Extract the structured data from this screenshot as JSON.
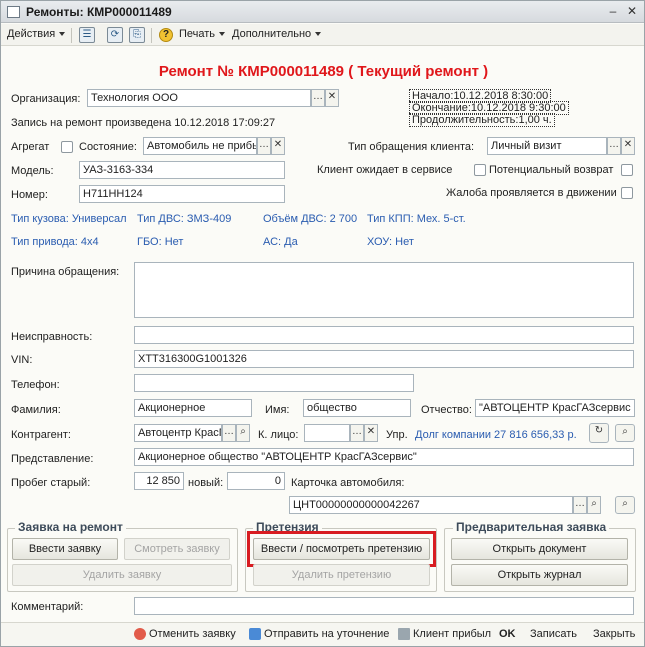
{
  "window": {
    "title": "Ремонты: КМР000011489"
  },
  "toolbar": {
    "actions": "Действия",
    "print": "Печать",
    "more": "Дополнительно"
  },
  "header": {
    "title": "Ремонт № КМР000011489 ( Текущий ремонт )"
  },
  "org": {
    "label": "Организация:",
    "value": "Технология ООО"
  },
  "timing": {
    "start": "Начало:10.12.2018 8:30:00",
    "end": "Окончание:10.12.2018 9:30:00",
    "duration": "Продолжительность:1,00 ч."
  },
  "record": "Запись на ремонт произведена 10.12.2018 17:09:27",
  "aggregate_label": "Агрегат",
  "state": {
    "label": "Состояние:",
    "value": "Автомобиль не прибь"
  },
  "client_type": {
    "label": "Тип обращения клиента:",
    "value": "Личный визит"
  },
  "model": {
    "label": "Модель:",
    "value": "УАЗ-3163-334"
  },
  "number": {
    "label": "Номер:",
    "value": "Н711НН124"
  },
  "client_waits": "Клиент ожидает в сервисе",
  "potential_return": "Потенциальный возврат",
  "complaint_motion": "Жалоба проявляется в движении",
  "specs": {
    "body": "Тип кузова: Универсал",
    "engine": "Тип ДВС: ЗМЗ-409",
    "volume": "Объём ДВС: 2 700",
    "gearbox": "Тип КПП: Мех. 5-ст.",
    "drive": "Тип привода: 4x4",
    "gbo": "ГБО: Нет",
    "ac": "АС: Да",
    "hou": "ХОУ: Нет"
  },
  "reason_label": "Причина обращения:",
  "fault_label": "Неисправность:",
  "vin": {
    "label": "VIN:",
    "value": "XTT316300G1001326"
  },
  "phone_label": "Телефон:",
  "surname": {
    "label": "Фамилия:",
    "value": "Акционерное"
  },
  "name": {
    "label": "Имя:",
    "value": "общество"
  },
  "patronymic": {
    "label": "Отчество:",
    "value": "\"АВТОЦЕНТР КрасГАЗсервис"
  },
  "counterparty": {
    "label": "Контрагент:",
    "value": "Автоцентр КрасГ"
  },
  "person_label": "К. лицо:",
  "upr_label": "Упр.",
  "debt": "Долг компании 27 816 656,33 р.",
  "representation": {
    "label": "Представление:",
    "value": "Акционерное общество \"АВТОЦЕНТР КрасГАЗсервис\""
  },
  "mileage": {
    "old_label": "Пробег старый:",
    "old_value": "12 850",
    "new_label": "новый:",
    "new_value": "0"
  },
  "card": {
    "label": "Карточка автомобиля:",
    "value": "ЦНТ00000000000042267"
  },
  "groups": {
    "request": {
      "title": "Заявка на ремонт",
      "enter": "Ввести заявку",
      "view": "Смотреть заявку",
      "delete": "Удалить заявку"
    },
    "claim": {
      "title": "Претензия",
      "enter": "Ввести / посмотреть претензию",
      "delete": "Удалить претензию"
    },
    "prelim": {
      "title": "Предварительная заявка",
      "open_doc": "Открыть документ",
      "open_journal": "Открыть журнал"
    }
  },
  "comment_label": "Комментарий:",
  "footer": {
    "cancel": "Отменить заявку",
    "send": "Отправить на уточнение",
    "arrived": "Клиент прибыл",
    "ok": "OK",
    "save": "Записать",
    "close": "Закрыть"
  }
}
